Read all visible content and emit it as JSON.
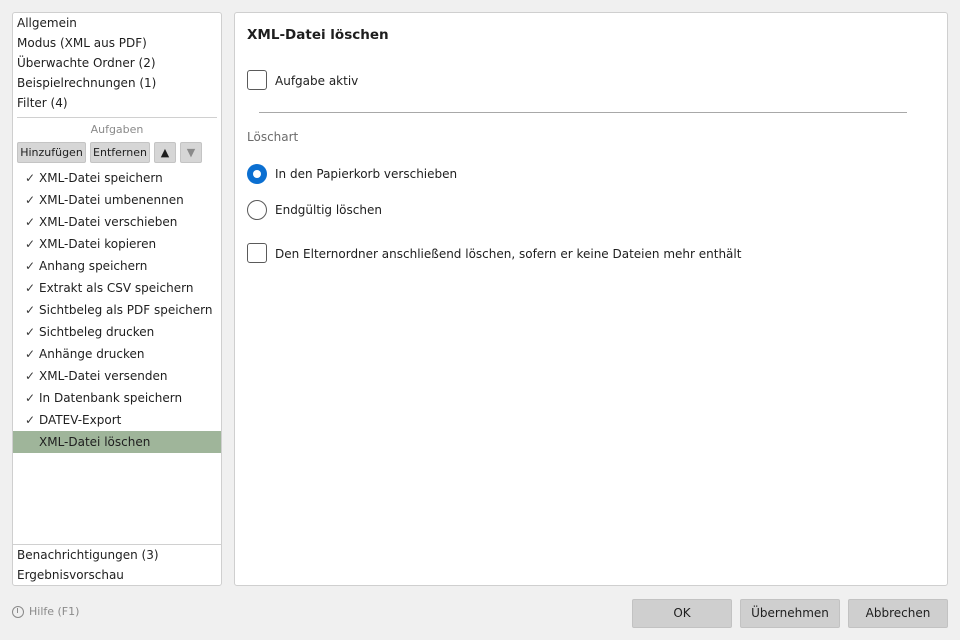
{
  "sidebar": {
    "top_items": [
      "Allgemein",
      "Modus (XML aus PDF)",
      "Überwachte Ordner (2)",
      "Beispielrechnungen (1)",
      "Filter (4)"
    ],
    "section_label": "Aufgaben",
    "toolbar": {
      "add": "Hinzufügen",
      "remove": "Entfernen",
      "up": "▲",
      "down": "▼"
    },
    "tasks": [
      {
        "label": "XML-Datei speichern",
        "check": "✓"
      },
      {
        "label": "XML-Datei umbenennen",
        "check": "✓"
      },
      {
        "label": "XML-Datei verschieben",
        "check": "✓"
      },
      {
        "label": "XML-Datei kopieren",
        "check": "✓"
      },
      {
        "label": "Anhang speichern",
        "check": "✓"
      },
      {
        "label": "Extrakt als CSV speichern",
        "check": "✓"
      },
      {
        "label": "Sichtbeleg als PDF speichern",
        "check": "✓"
      },
      {
        "label": "Sichtbeleg drucken",
        "check": "✓"
      },
      {
        "label": "Anhänge drucken",
        "check": "✓"
      },
      {
        "label": "XML-Datei versenden",
        "check": "✓"
      },
      {
        "label": "In Datenbank speichern",
        "check": "✓"
      },
      {
        "label": "DATEV-Export",
        "check": "✓"
      },
      {
        "label": "XML-Datei löschen",
        "check": ""
      }
    ],
    "selected_task_index": 12,
    "bottom_items": [
      "Benachrichtigungen (3)",
      "Ergebnisvorschau"
    ]
  },
  "main": {
    "title": "XML-Datei löschen",
    "task_active_label": "Aufgabe aktiv",
    "task_active_checked": false,
    "group_label": "Löschart",
    "radio_move_label": "In den Papierkorb verschieben",
    "radio_delete_label": "Endgültig löschen",
    "selected_option": "move",
    "delete_parent_label": "Den Elternordner anschließend löschen, sofern er keine Dateien mehr enthält",
    "delete_parent_checked": false
  },
  "footer": {
    "help": "Hilfe (F1)",
    "ok": "OK",
    "apply": "Übernehmen",
    "cancel": "Abbrechen"
  },
  "colors": {
    "selection": "#9fb59a",
    "accent": "#0b6fd1",
    "button": "#cfcfcf"
  }
}
